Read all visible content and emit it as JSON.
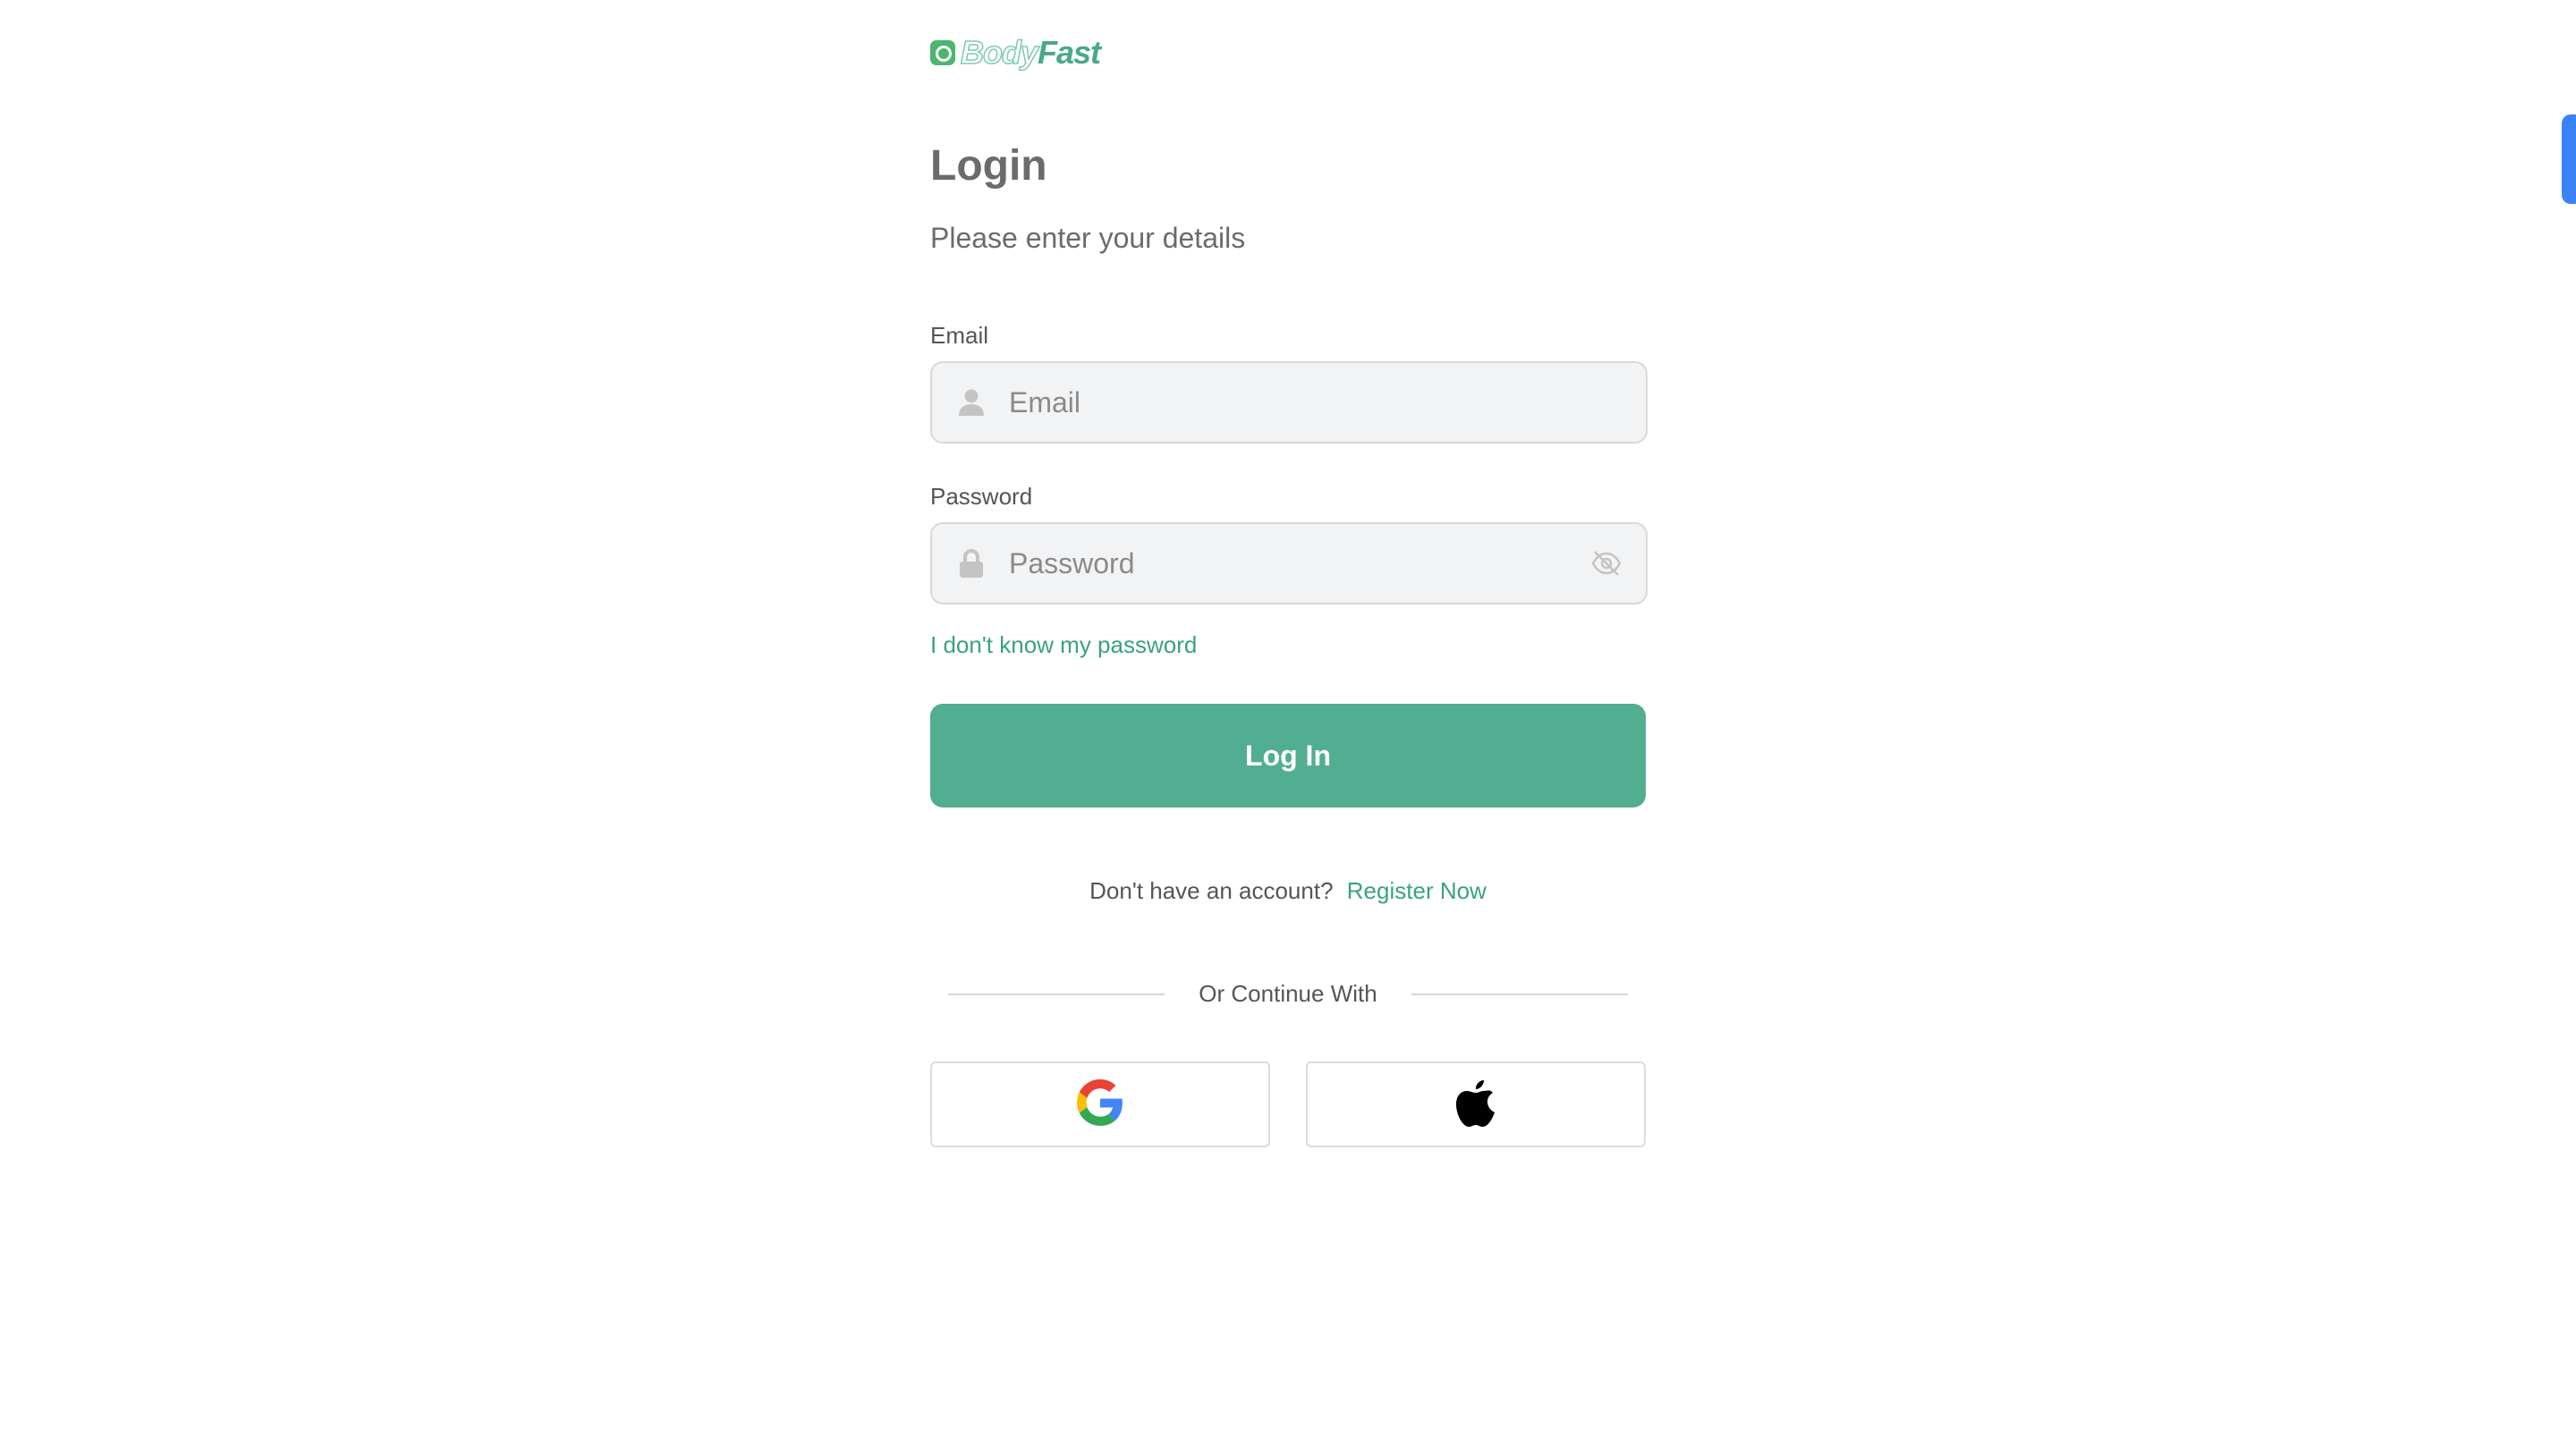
{
  "brand": {
    "name_part1": "Body",
    "name_part2": "Fast",
    "icon": "bodyfast-logo-icon"
  },
  "header": {
    "title": "Login",
    "subtitle": "Please enter your details"
  },
  "form": {
    "email": {
      "label": "Email",
      "placeholder": "Email",
      "value": "",
      "icon": "user-icon"
    },
    "password": {
      "label": "Password",
      "placeholder": "Password",
      "value": "",
      "icon": "lock-icon",
      "toggle_icon": "eye-off-icon"
    },
    "forgot_link": "I don't know my password",
    "submit_label": "Log In"
  },
  "register": {
    "prompt": "Don't have an account?",
    "link": "Register Now"
  },
  "social": {
    "divider_text": "Or Continue With",
    "providers": [
      {
        "name": "Google",
        "icon": "google-icon"
      },
      {
        "name": "Apple",
        "icon": "apple-icon"
      }
    ]
  },
  "colors": {
    "accent": "#52ae91",
    "link": "#3aa183",
    "input_bg": "#f2f3f5",
    "side_tab": "#3b82f6"
  }
}
